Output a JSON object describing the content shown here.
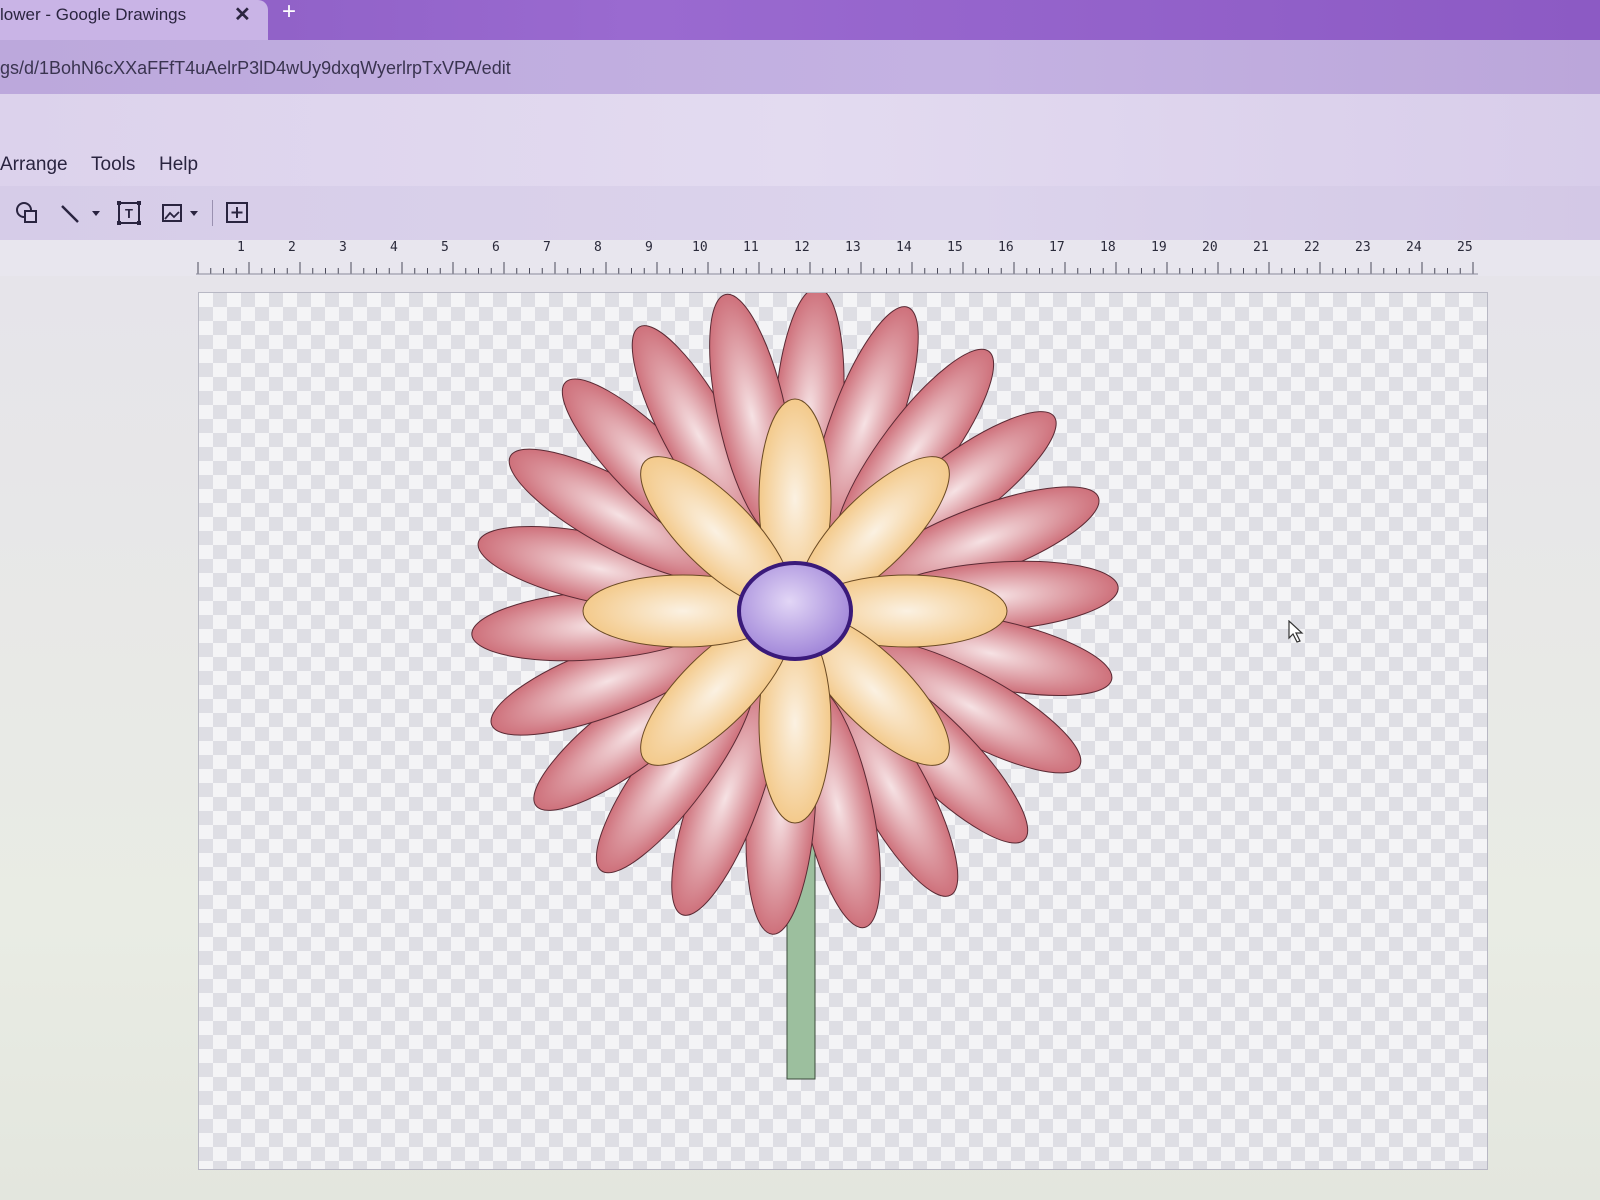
{
  "tab": {
    "title": "lower - Google Drawings",
    "close": "✕",
    "new": "+"
  },
  "address": {
    "url": "gs/d/1BohN6cXXaFFfT4uAelrP3lD4wUy9dxqWyerlrpTxVPA/edit"
  },
  "menu": {
    "items": [
      "Arrange",
      "Tools",
      "Help"
    ]
  },
  "toolbar": {
    "icons": [
      "shape-icon",
      "line-icon",
      "text-box-icon",
      "image-icon",
      "add-comment-icon"
    ]
  },
  "ruler": {
    "labels": [
      "1",
      "2",
      "3",
      "4",
      "5",
      "6",
      "7",
      "8",
      "9",
      "10",
      "11",
      "12",
      "13",
      "14",
      "15",
      "16",
      "17",
      "18",
      "19",
      "20",
      "21",
      "22",
      "23",
      "24",
      "25"
    ]
  },
  "drawing": {
    "outer_petal_color": "#c65a66",
    "inner_petal_color": "#f2c27a",
    "center_color": "#9b7fd6",
    "center_stroke": "#3a1a7a",
    "stem_color": "#9cbf9e"
  }
}
